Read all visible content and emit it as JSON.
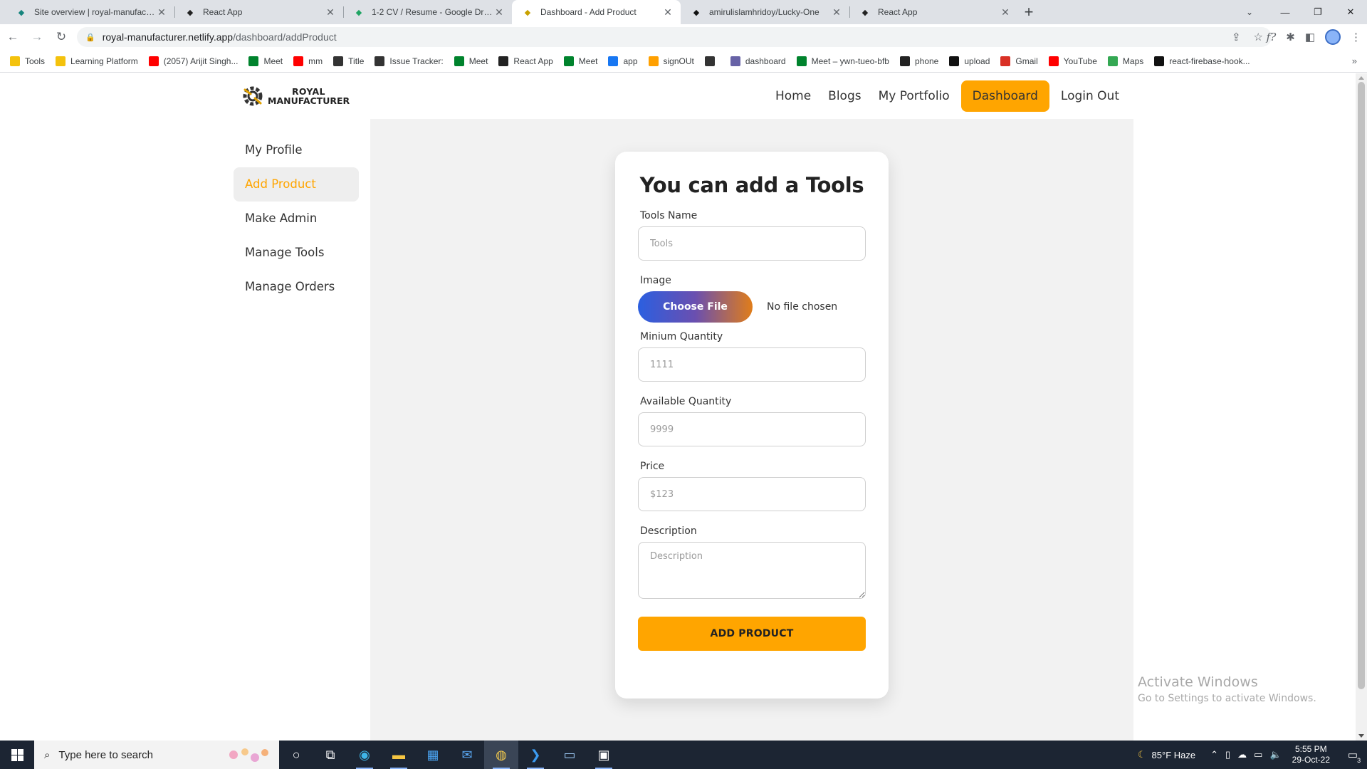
{
  "browser": {
    "tabs": [
      {
        "title": "Site overview | royal-manufactur",
        "icon": "netlify-icon",
        "color": "#15847d"
      },
      {
        "title": "React App",
        "icon": "react-icon",
        "color": "#222"
      },
      {
        "title": "1-2 CV / Resume - Google Drive",
        "icon": "drive-icon",
        "color": "#1fa463"
      },
      {
        "title": "Dashboard - Add Product",
        "icon": "gear-logo-icon",
        "color": "#c8a100",
        "active": true
      },
      {
        "title": "amirulislamhridoy/Lucky-One",
        "icon": "github-icon",
        "color": "#111"
      },
      {
        "title": "React App",
        "icon": "react-icon",
        "color": "#222"
      }
    ],
    "url_host": "royal-manufacturer.netlify.app",
    "url_path": "/dashboard/addProduct",
    "bookmarks": [
      {
        "label": "Tools",
        "icon": "folder-icon",
        "color": "#f4c20d"
      },
      {
        "label": "Learning Platform",
        "icon": "folder-icon",
        "color": "#f4c20d"
      },
      {
        "label": "(2057) Arijit Singh...",
        "icon": "youtube-icon",
        "color": "#ff0000"
      },
      {
        "label": "Meet",
        "icon": "meet-icon",
        "color": "#00832d"
      },
      {
        "label": "mm",
        "icon": "youtube-icon",
        "color": "#ff0000"
      },
      {
        "label": "Title",
        "icon": "globe-icon",
        "color": "#333333"
      },
      {
        "label": "Issue Tracker:",
        "icon": "globe-icon",
        "color": "#333333"
      },
      {
        "label": "Meet",
        "icon": "meet-icon",
        "color": "#00832d"
      },
      {
        "label": "React App",
        "icon": "react-icon",
        "color": "#222222"
      },
      {
        "label": "Meet",
        "icon": "meet-icon",
        "color": "#00832d"
      },
      {
        "label": "app",
        "icon": "facebook-icon",
        "color": "#1877f2"
      },
      {
        "label": "signOUt",
        "icon": "firebase-icon",
        "color": "#ffa000"
      },
      {
        "label": "",
        "icon": "dots-icon",
        "color": "#333333"
      },
      {
        "label": "dashboard",
        "icon": "heroku-icon",
        "color": "#6762a6"
      },
      {
        "label": "Meet – ywn-tueo-bfb",
        "icon": "meet-icon",
        "color": "#00832d"
      },
      {
        "label": "phone",
        "icon": "react-icon",
        "color": "#222222"
      },
      {
        "label": "upload",
        "icon": "m-icon",
        "color": "#111111"
      },
      {
        "label": "Gmail",
        "icon": "gmail-icon",
        "color": "#d93025"
      },
      {
        "label": "YouTube",
        "icon": "youtube-icon",
        "color": "#ff0000"
      },
      {
        "label": "Maps",
        "icon": "maps-icon",
        "color": "#34a853"
      },
      {
        "label": "react-firebase-hook...",
        "icon": "github-icon",
        "color": "#111111"
      }
    ]
  },
  "site": {
    "brand_line1": "ROYAL",
    "brand_line2": "MANUFACTURER",
    "nav": [
      "Home",
      "Blogs",
      "My Portfolio",
      "Dashboard",
      "Login Out"
    ],
    "sidebar": [
      "My Profile",
      "Add Product",
      "Make Admin",
      "Manage Tools",
      "Manage Orders"
    ],
    "accent": "#ffa500"
  },
  "form": {
    "title": "You can add a Tools",
    "name_label": "Tools Name",
    "name_placeholder": "Tools",
    "image_label": "Image",
    "file_button": "Choose File",
    "file_status": "No file chosen",
    "min_label": "Minium Quantity",
    "min_placeholder": "1111",
    "avail_label": "Available Quantity",
    "avail_placeholder": "9999",
    "price_label": "Price",
    "price_placeholder": "$123",
    "desc_label": "Description",
    "desc_placeholder": "Description",
    "submit": "ADD PRODUCT"
  },
  "watermark": {
    "line1": "Activate Windows",
    "line2": "Go to Settings to activate Windows."
  },
  "taskbar": {
    "search_placeholder": "Type here to search",
    "weather": "85°F  Haze",
    "time": "5:55 PM",
    "date": "29-Oct-22",
    "notifications": "3"
  }
}
